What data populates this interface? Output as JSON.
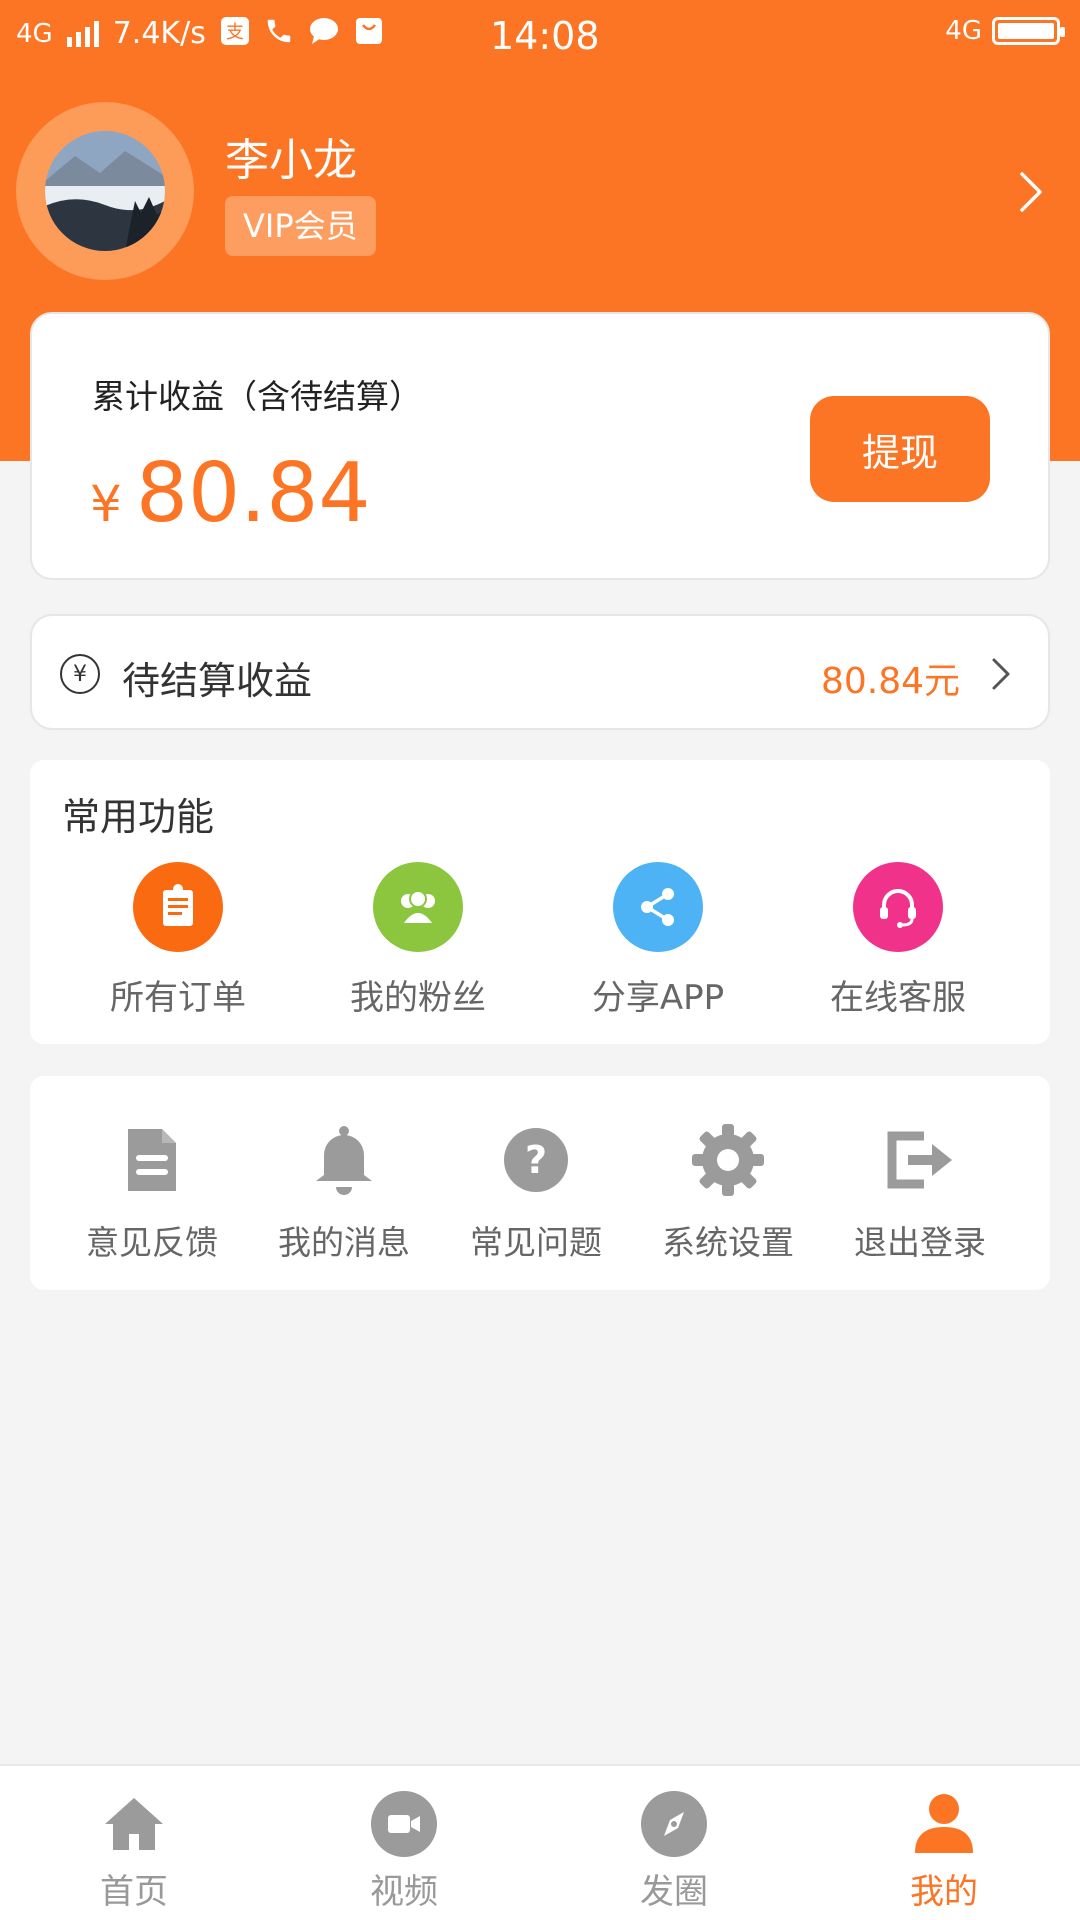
{
  "status_bar": {
    "network_left": "4G",
    "speed": "7.4K/s",
    "time": "14:08",
    "network_right": "4G",
    "icons": [
      "signal-icon",
      "alipay-icon",
      "phone-icon",
      "message-icon",
      "shopping-bag-icon"
    ]
  },
  "profile": {
    "name": "李小龙",
    "badge": "VIP会员"
  },
  "earnings": {
    "label": "累计收益（含待结算）",
    "currency": "¥",
    "amount": "80.84",
    "withdraw_label": "提现"
  },
  "pending": {
    "label": "待结算收益",
    "value": "80.84元",
    "icon": "yen-coin-icon"
  },
  "functions": {
    "title": "常用功能",
    "items": [
      {
        "label": "所有订单",
        "icon": "orders-icon",
        "color": "#fa6a10"
      },
      {
        "label": "我的粉丝",
        "icon": "fans-icon",
        "color": "#8cc63f"
      },
      {
        "label": "分享APP",
        "icon": "share-icon",
        "color": "#4db3f5"
      },
      {
        "label": "在线客服",
        "icon": "headset-icon",
        "color": "#f0328a"
      }
    ]
  },
  "tools": {
    "items": [
      {
        "label": "意见反馈",
        "icon": "feedback-icon"
      },
      {
        "label": "我的消息",
        "icon": "bell-icon"
      },
      {
        "label": "常见问题",
        "icon": "question-icon"
      },
      {
        "label": "系统设置",
        "icon": "gear-icon"
      },
      {
        "label": "退出登录",
        "icon": "logout-icon"
      }
    ]
  },
  "nav": {
    "items": [
      {
        "label": "首页",
        "icon": "home-icon"
      },
      {
        "label": "视频",
        "icon": "video-icon"
      },
      {
        "label": "发圈",
        "icon": "compass-icon"
      },
      {
        "label": "我的",
        "icon": "user-icon"
      }
    ],
    "active": "我的"
  },
  "colors": {
    "accent": "#fc7525",
    "background": "#f4f4f4",
    "icon_gray": "#9b9b9b"
  }
}
